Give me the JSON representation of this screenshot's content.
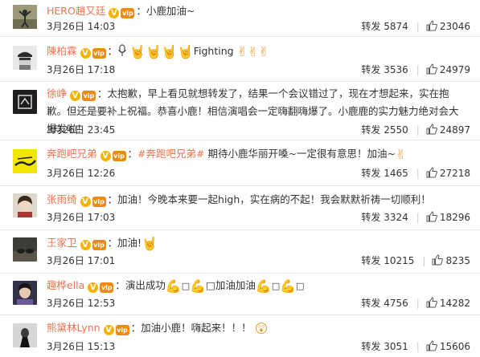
{
  "comments": [
    {
      "name": "HERO趙又廷",
      "v": "V",
      "vip": "vip",
      "colon": "：",
      "text": "小鹿加油~",
      "time": "3月26日 14:03",
      "repost_label": "转发",
      "reposts": "5874",
      "likes": "23046"
    },
    {
      "name": "陳柏霖",
      "v": "V",
      "vip": "vip",
      "colon": "：",
      "prefix_icon": "microphone-icon",
      "emoji_a": "🤘🤘🤘🤘",
      "text": "Fighting",
      "emoji_b": "✌✌✌",
      "time": "3月26日 17:18",
      "repost_label": "转发",
      "reposts": "3536",
      "likes": "24979"
    },
    {
      "name": "徐峥",
      "v": "V",
      "vip": "vip",
      "colon": "：",
      "text": "太抱歉，早上看见就想转发了，结果一个会议错过了，现在才想起来，实在抱歉。但还是要补上祝福。恭喜小鹿！相信演唱会一定嗨翻嗨爆了。小鹿鹿的实力魅力绝对会大爆发啦！",
      "time": "3月26日 23:45",
      "repost_label": "转发",
      "reposts": "2550",
      "likes": "24897"
    },
    {
      "name": "奔跑吧兄弟",
      "v": "V",
      "vip": "vip",
      "colon": "：",
      "topic": "#奔跑吧兄弟#",
      "text": "期待小鹿华丽开嗓~一定很有意思！加油~",
      "emoji": "✌",
      "time": "3月26日 12:26",
      "repost_label": "转发",
      "reposts": "1465",
      "likes": "27218"
    },
    {
      "name": "张雨绮",
      "v": "V",
      "vip": "vip",
      "colon": "：",
      "text": "加油！今晚本来要一起high，实在病的不起！我会默默祈祷一切顺利！",
      "time": "3月26日 17:03",
      "repost_label": "转发",
      "reposts": "3324",
      "likes": "18296"
    },
    {
      "name": "王家卫",
      "v": "V",
      "vip": "vip",
      "colon": "：",
      "text": "加油!",
      "emoji": "🤘",
      "time": "3月26日 17:01",
      "repost_label": "转发",
      "reposts": "10215",
      "likes": "8235"
    },
    {
      "name": "趣桦ella",
      "v": "V",
      "vip": "vip",
      "colon": "：",
      "text_a": "演出成功",
      "emoji_1": "💪",
      "box": "□",
      "emoji_2": "💪",
      "text_b": "□加油加油",
      "emoji_3": "💪",
      "emoji_4": "💪",
      "time": "3月26日 12:53",
      "repost_label": "转发",
      "reposts": "4756",
      "likes": "14282"
    },
    {
      "name": "熊黛林Lynn",
      "v": "V",
      "vip": "vip",
      "colon": "：",
      "text": "加油小鹿！嗨起来！！！",
      "emoji": "😲",
      "time": "3月26日 15:13",
      "repost_label": "转发",
      "reposts": "3051",
      "likes": "15606"
    }
  ],
  "colors": {
    "name": "#eb7350",
    "text": "#333333",
    "v_badge": "#f7b100",
    "vip_badge": "#e98b14",
    "divider": "#e6e6e6"
  },
  "icons": {
    "like": "thumbs-up-icon"
  }
}
